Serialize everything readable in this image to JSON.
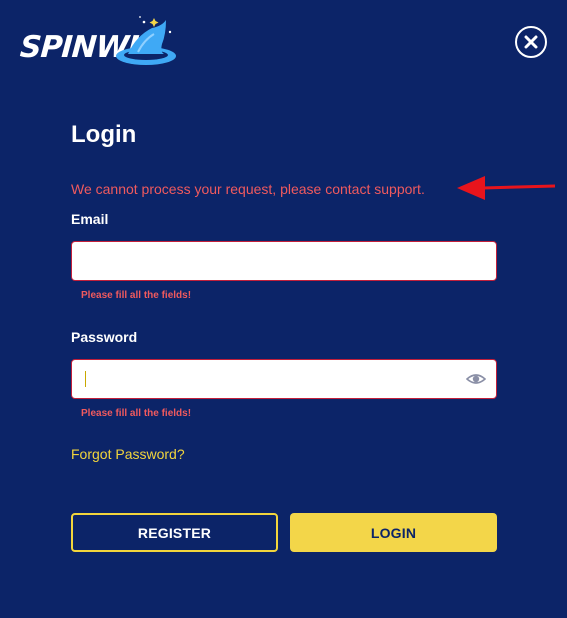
{
  "brand": {
    "logo_text": "SPINWIZ"
  },
  "login": {
    "title": "Login",
    "error_message": "We cannot process your request, please contact support.",
    "email": {
      "label": "Email",
      "value": "",
      "placeholder": "",
      "error": "Please fill all the fields!"
    },
    "password": {
      "label": "Password",
      "value": "",
      "placeholder": "",
      "error": "Please fill all the fields!"
    },
    "forgot_password": "Forgot Password?",
    "register_button": "REGISTER",
    "login_button": "LOGIN"
  },
  "colors": {
    "background": "#0c2468",
    "accent_yellow": "#f3d649",
    "error_red": "#f05a5e",
    "annotation_arrow": "#e8141c"
  },
  "icons": [
    "close-icon",
    "eye-icon",
    "wizard-hat-icon",
    "annotation-arrow"
  ]
}
